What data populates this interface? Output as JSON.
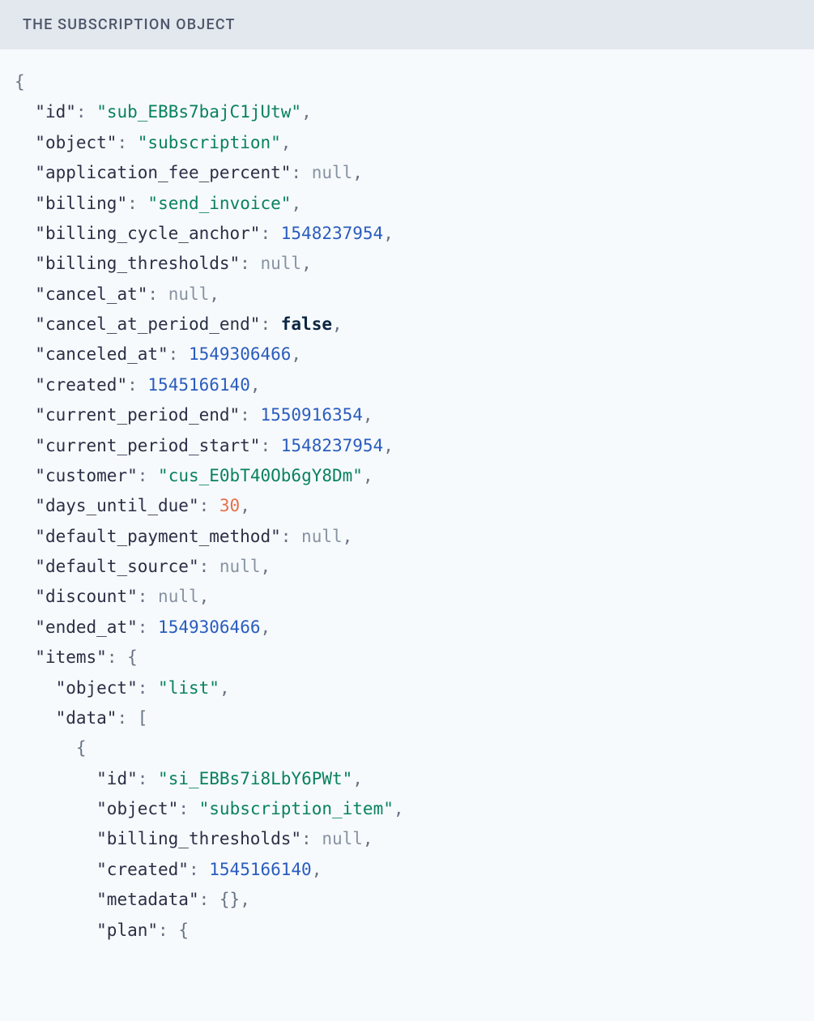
{
  "header_title": "THE SUBSCRIPTION OBJECT",
  "subscription": {
    "id": "sub_EBBs7bajC1jUtw",
    "object": "subscription",
    "application_fee_percent": null,
    "billing": "send_invoice",
    "billing_cycle_anchor": 1548237954,
    "billing_thresholds": null,
    "cancel_at": null,
    "cancel_at_period_end": false,
    "canceled_at": 1549306466,
    "created": 1545166140,
    "current_period_end": 1550916354,
    "current_period_start": 1548237954,
    "customer": "cus_E0bT40Ob6gY8Dm",
    "days_until_due": 30,
    "default_payment_method": null,
    "default_source": null,
    "discount": null,
    "ended_at": 1549306466,
    "items": {
      "object": "list",
      "data": [
        {
          "id": "si_EBBs7i8LbY6PWt",
          "object": "subscription_item",
          "billing_thresholds": null,
          "created": 1545166140,
          "metadata": {},
          "plan": {}
        }
      ]
    }
  },
  "highlight_paths": [
    "subscription.days_until_due"
  ]
}
